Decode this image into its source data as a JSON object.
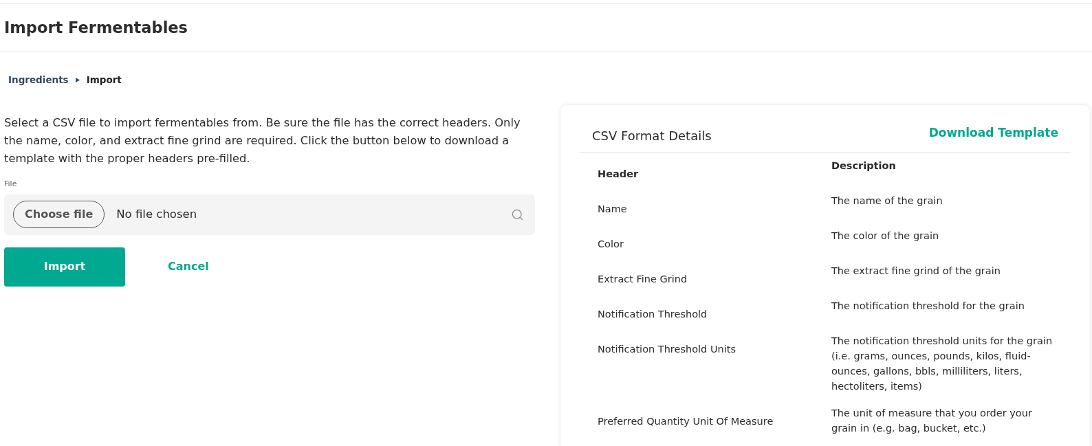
{
  "page": {
    "title": "Import Fermentables"
  },
  "breadcrumb": [
    {
      "label": "Ingredients",
      "kind": "link"
    },
    {
      "label": "Import",
      "kind": "current"
    }
  ],
  "form": {
    "intro": "Select a CSV file to import fermentables from. Be sure the file has the correct headers. Only the name, color, and extract fine grind are required. Click the button below to download a template with the proper headers pre-filled.",
    "file_field": {
      "label": "File",
      "button": "Choose file",
      "value": "No file chosen"
    },
    "buttons": [
      {
        "label": "Import",
        "kind": "primary"
      },
      {
        "label": "Cancel",
        "kind": "link"
      }
    ]
  },
  "csv_panel": {
    "title": "CSV Format Details",
    "action": "Download Template",
    "table": {
      "columns": [
        "Header",
        "Description"
      ],
      "rows": [
        {
          "header": "Name",
          "description": "The name of the grain"
        },
        {
          "header": "Color",
          "description": "The color of the grain"
        },
        {
          "header": "Extract Fine Grind",
          "description": "The extract fine grind of the grain"
        },
        {
          "header": "Notification Threshold",
          "description": "The notification threshold for the grain"
        },
        {
          "header": "Notification Threshold Units",
          "description": "The notification threshold units for the grain (i.e. grams, ounces, pounds, kilos, fluid-ounces, gallons, bbls, milliliters, liters, hectoliters, items)"
        },
        {
          "header": "Preferred Quantity Unit Of Measure",
          "description": "The unit of measure that you order your grain in (e.g. bag, bucket, etc.)"
        }
      ]
    }
  }
}
